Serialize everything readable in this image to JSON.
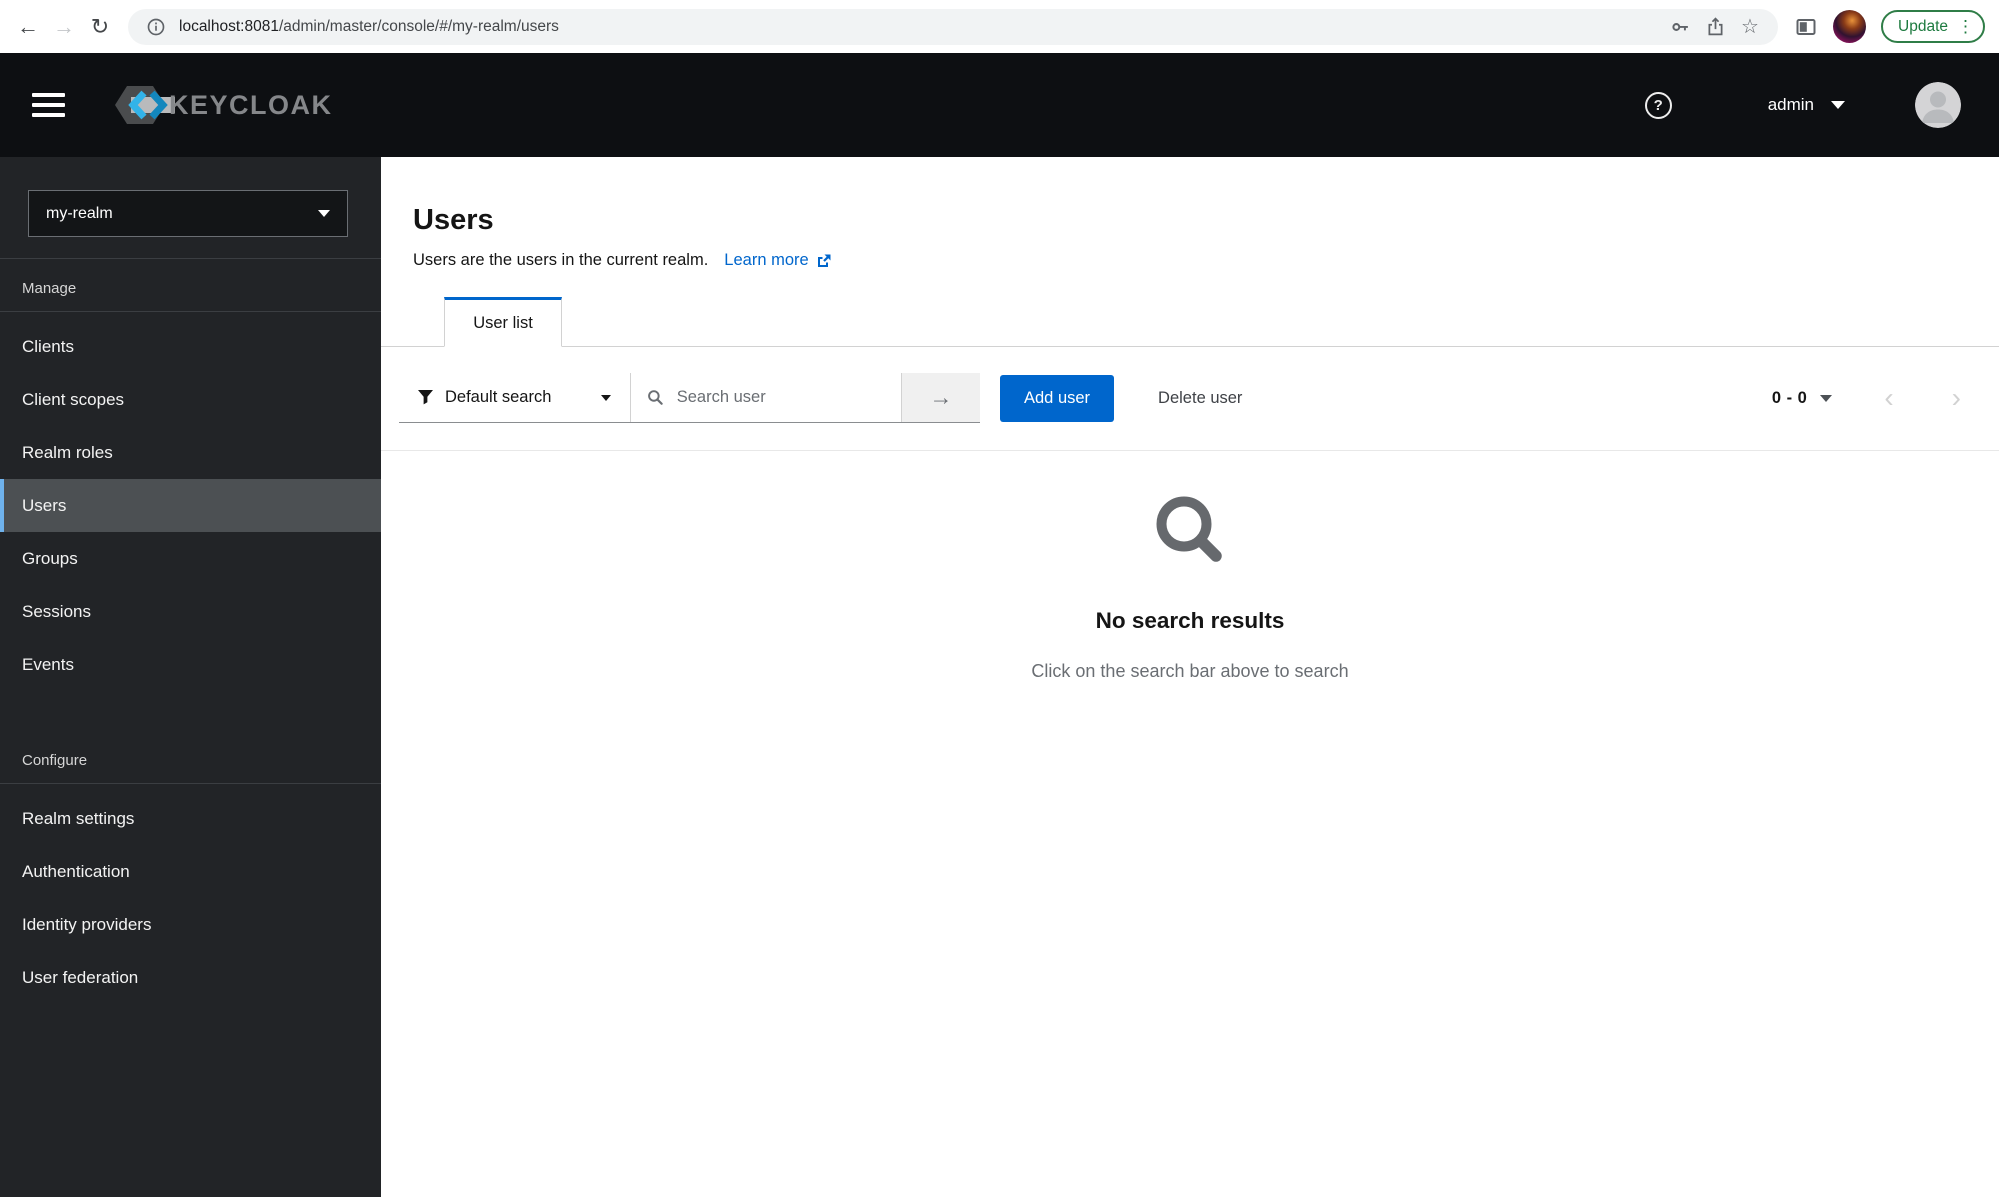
{
  "browser": {
    "url_host": "localhost:8081",
    "url_path": "/admin/master/console/#/my-realm/users",
    "update_label": "Update"
  },
  "icons": {
    "back": "←",
    "forward": "→",
    "reload": "↻",
    "star": "☆",
    "menu_dots": "⋮",
    "help": "?",
    "submit_arrow": "→",
    "prev": "‹",
    "next": "›"
  },
  "header": {
    "brand": "KEYCLOAK",
    "username": "admin"
  },
  "sidebar": {
    "realm": "my-realm",
    "sections": [
      {
        "label": "Manage",
        "items": [
          {
            "label": "Clients",
            "active": false
          },
          {
            "label": "Client scopes",
            "active": false
          },
          {
            "label": "Realm roles",
            "active": false
          },
          {
            "label": "Users",
            "active": true
          },
          {
            "label": "Groups",
            "active": false
          },
          {
            "label": "Sessions",
            "active": false
          },
          {
            "label": "Events",
            "active": false
          }
        ]
      },
      {
        "label": "Configure",
        "items": [
          {
            "label": "Realm settings",
            "active": false
          },
          {
            "label": "Authentication",
            "active": false
          },
          {
            "label": "Identity providers",
            "active": false
          },
          {
            "label": "User federation",
            "active": false
          }
        ]
      }
    ]
  },
  "main": {
    "title": "Users",
    "description": "Users are the users in the current realm.",
    "learn_more_label": "Learn more",
    "tabs": [
      {
        "label": "User list"
      }
    ],
    "toolbar": {
      "filter_label": "Default search",
      "search_placeholder": "Search user",
      "add_user_label": "Add user",
      "delete_user_label": "Delete user",
      "pagination_range": "0 - 0"
    },
    "empty_state": {
      "title": "No search results",
      "subtitle": "Click on the search bar above to search"
    }
  },
  "colors": {
    "accent_blue": "#0066cc",
    "nav_active_border": "#6fb2ec",
    "update_green": "#1a7d3f",
    "sidebar_bg": "#222427",
    "header_bg": "#0d0f12"
  }
}
